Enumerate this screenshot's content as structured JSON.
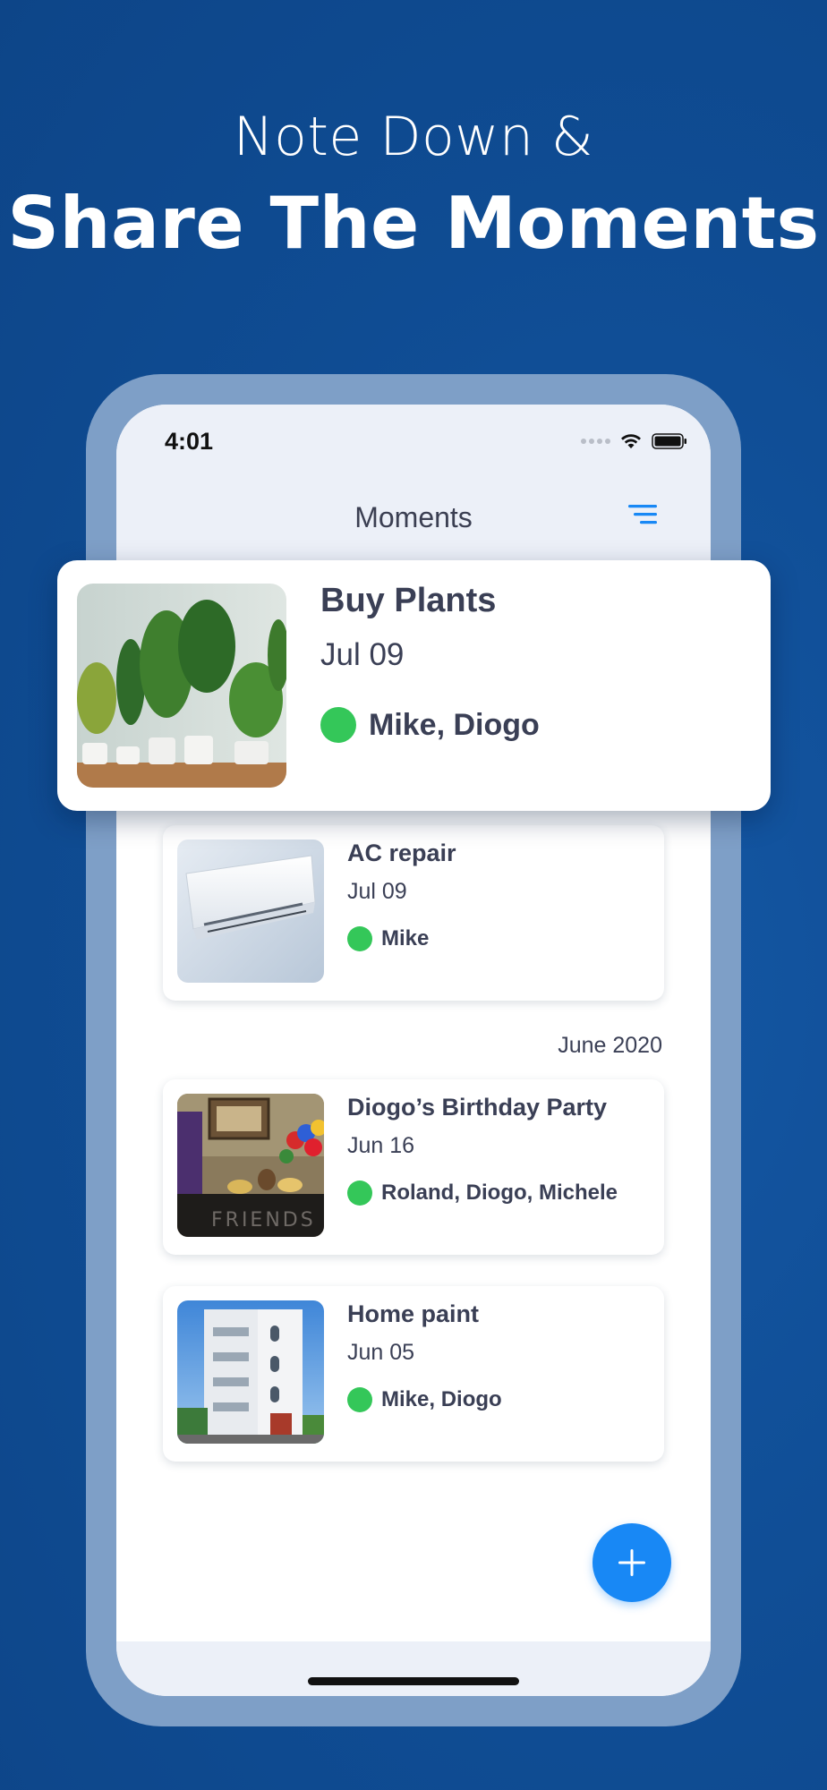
{
  "colors": {
    "background": "#0f4c93",
    "phone_frame": "#7e9fc7",
    "accent": "#1888f5",
    "status_dot": "#34c759",
    "text": "#3a3f55"
  },
  "headline": {
    "line1": "Note Down &",
    "line2": "Share The Moments"
  },
  "status_bar": {
    "time": "4:01",
    "icons": [
      "signal-icon",
      "wifi-icon",
      "battery-icon"
    ]
  },
  "nav": {
    "title": "Moments",
    "filter_icon": "filter-icon"
  },
  "featured": {
    "title": "Buy Plants",
    "date": "Jul 09",
    "people": "Mike, Diogo",
    "image": "potted-plants-photo"
  },
  "moments": [
    {
      "title": "AC repair",
      "date": "Jul 09",
      "people": "Mike",
      "image": "air-conditioner-photo"
    },
    {
      "title": "Diogo’s Birthday Party",
      "date": "Jun 16",
      "people": "Roland, Diogo, Michele",
      "image": "birthday-party-photo"
    },
    {
      "title": "Home paint",
      "date": "Jun 05",
      "people": "Mike, Diogo",
      "image": "building-photo"
    }
  ],
  "section_label": "June 2020",
  "fab": {
    "icon": "plus-icon"
  }
}
